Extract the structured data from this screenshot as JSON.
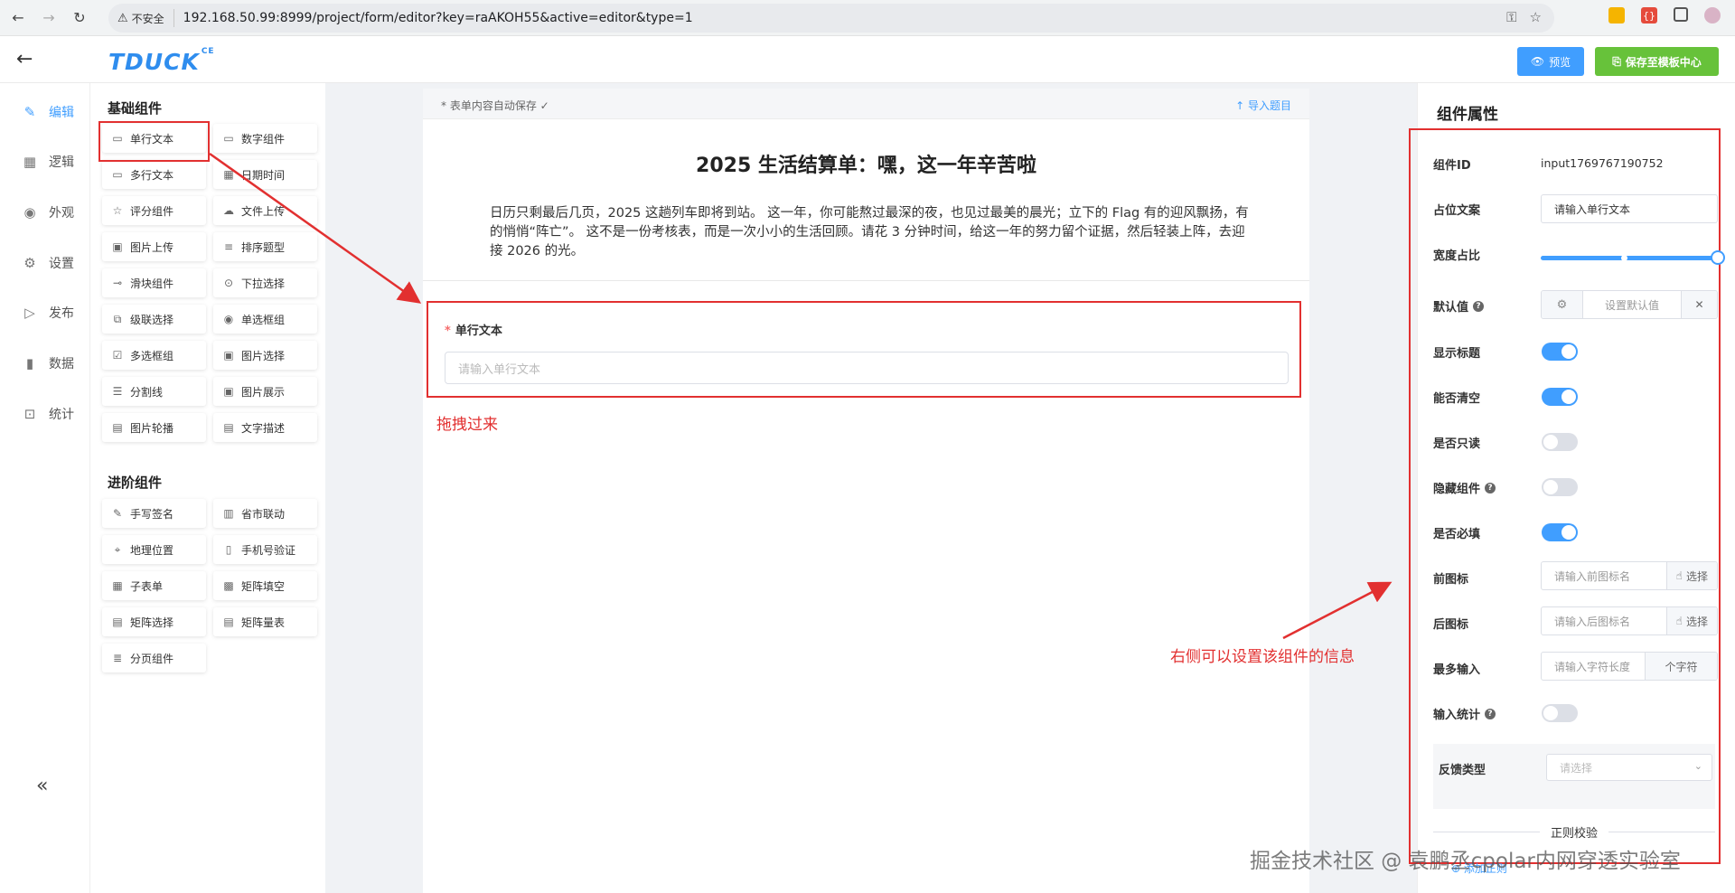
{
  "browser": {
    "security_label": "不安全",
    "url": "192.168.50.99:8999/project/form/editor?key=raAKOH55&active=editor&type=1"
  },
  "header": {
    "logo": "TDUCK",
    "logo_sup": "CE",
    "preview_label": "预览",
    "save_template_label": "保存至模板中心",
    "colors": {
      "primary": "#409eff",
      "success": "#67c23a",
      "annotation_red": "#e23030"
    }
  },
  "left_nav": {
    "items": [
      {
        "label": "编辑",
        "icon": "edit-icon",
        "active": true
      },
      {
        "label": "逻辑",
        "icon": "grid-icon"
      },
      {
        "label": "外观",
        "icon": "eye-icon"
      },
      {
        "label": "设置",
        "icon": "gear-icon"
      },
      {
        "label": "发布",
        "icon": "play-circle-icon"
      },
      {
        "label": "数据",
        "icon": "bar-chart-icon"
      },
      {
        "label": "统计",
        "icon": "stats-icon"
      }
    ],
    "collapse_icon": "double-chevron-left-icon"
  },
  "palette": {
    "basic_title": "基础组件",
    "basic_items": [
      "单行文本",
      "数字组件",
      "多行文本",
      "日期时间",
      "评分组件",
      "文件上传",
      "图片上传",
      "排序题型",
      "滑块组件",
      "下拉选择",
      "级联选择",
      "单选框组",
      "多选框组",
      "图片选择",
      "分割线",
      "图片展示",
      "图片轮播",
      "文字描述"
    ],
    "advanced_title": "进阶组件",
    "advanced_items": [
      "手写签名",
      "省市联动",
      "地理位置",
      "手机号验证",
      "子表单",
      "矩阵填空",
      "矩阵选择",
      "矩阵量表",
      "分页组件"
    ]
  },
  "form": {
    "autosave": "* 表单内容自动保存 ✓",
    "import_label": "↑  导入题目",
    "title": "2025 生活结算单：嘿，这一年辛苦啦",
    "description": "日历只剩最后几页，2025 这趟列车即将到站。 这一年，你可能熬过最深的夜，也见过最美的晨光；立下的 Flag 有的迎风飘扬，有的悄悄“阵亡”。 这不是一份考核表，而是一次小小的生活回顾。请花 3 分钟时间，给这一年的努力留个证据，然后轻装上阵，去迎接 2026 的光。",
    "field_label": "单行文本",
    "field_placeholder": "请输入单行文本"
  },
  "annotations": {
    "drag_note": "拖拽过来",
    "right_note": "右侧可以设置该组件的信息"
  },
  "props": {
    "title": "组件属性",
    "component_id_label": "组件ID",
    "component_id_value": "input1769767190752",
    "placeholder_label": "占位文案",
    "placeholder_value": "请输入单行文本",
    "width_label": "宽度占比",
    "width_ratio": 1.0,
    "default_label": "默认值",
    "default_placeholder": "设置默认值",
    "show_label_label": "显示标题",
    "show_label_on": true,
    "clearable_label": "能否清空",
    "clearable_on": true,
    "readonly_label": "是否只读",
    "readonly_on": false,
    "hidden_label": "隐藏组件",
    "hidden_on": false,
    "required_label": "是否必填",
    "required_on": true,
    "prefix_label": "前图标",
    "prefix_placeholder": "请输入前图标名",
    "suffix_label": "后图标",
    "suffix_placeholder": "请输入后图标名",
    "select_label": "选择",
    "maxlength_label": "最多输入",
    "maxlength_placeholder": "请输入字符长度",
    "maxlength_unit": "个字符",
    "word_count_label": "输入统计",
    "word_count_on": false,
    "feedback_label": "反馈类型",
    "feedback_placeholder": "请选择",
    "regex_title": "正则校验",
    "add_rule": "添加正则"
  },
  "watermark": "掘金技术社区 @ 袁鹏丞cpolar内网穿透实验室"
}
